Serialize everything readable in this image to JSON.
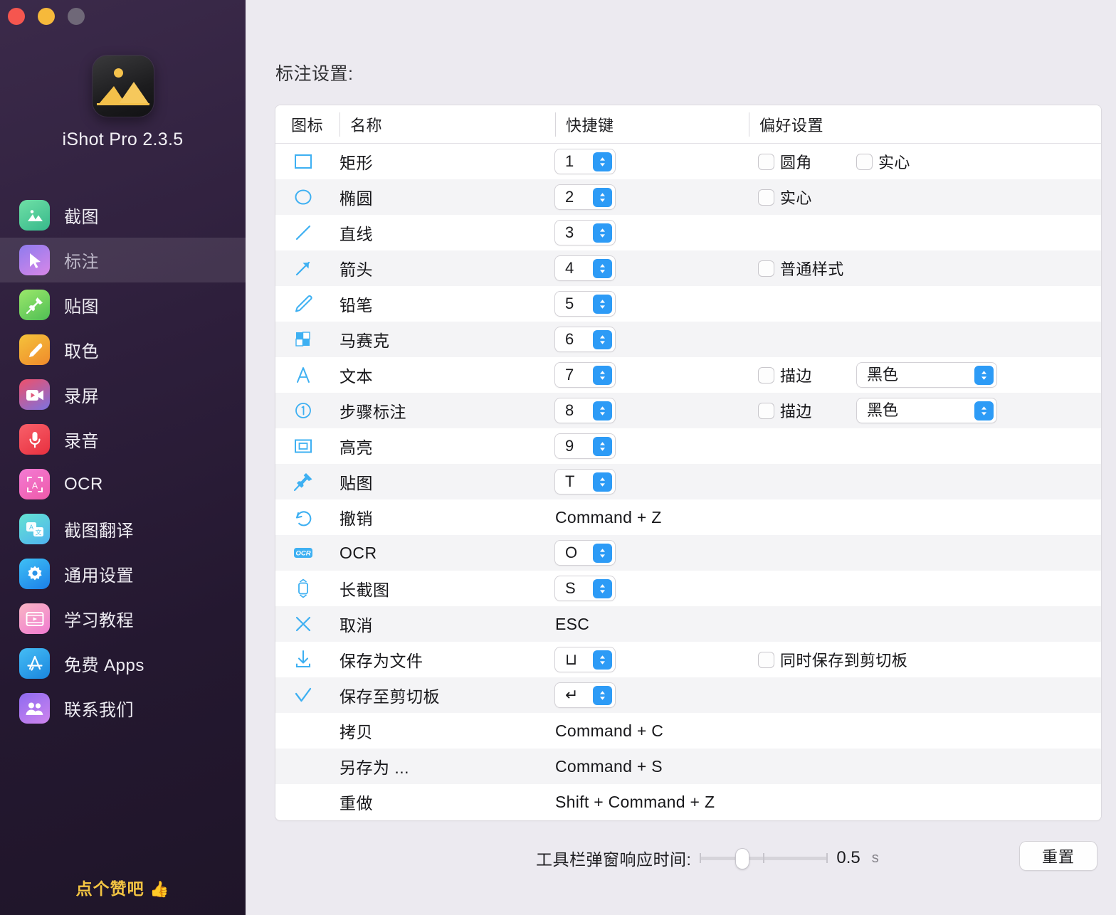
{
  "window": {
    "traffic_lights": [
      "close",
      "minimize",
      "zoom"
    ],
    "app_name": "iShot Pro 2.3.5"
  },
  "sidebar": {
    "items": [
      {
        "label": "截图",
        "icon": "screenshot-icon",
        "active": false
      },
      {
        "label": "标注",
        "icon": "annotate-icon",
        "active": true
      },
      {
        "label": "贴图",
        "icon": "pin-image-icon",
        "active": false
      },
      {
        "label": "取色",
        "icon": "color-picker-icon",
        "active": false
      },
      {
        "label": "录屏",
        "icon": "screen-record-icon",
        "active": false
      },
      {
        "label": "录音",
        "icon": "audio-record-icon",
        "active": false
      },
      {
        "label": "OCR",
        "icon": "ocr-icon",
        "active": false
      },
      {
        "label": "截图翻译",
        "icon": "translate-icon",
        "active": false
      },
      {
        "label": "通用设置",
        "icon": "gear-icon",
        "active": false
      },
      {
        "label": "学习教程",
        "icon": "tutorial-icon",
        "active": false
      },
      {
        "label": "免费 Apps",
        "icon": "app-store-icon",
        "active": false
      },
      {
        "label": "联系我们",
        "icon": "contacts-icon",
        "active": false
      }
    ],
    "praise_text": "点个赞吧",
    "praise_emoji": "👍"
  },
  "main": {
    "section_title": "标注设置:",
    "columns": [
      "图标",
      "名称",
      "快捷键",
      "偏好设置"
    ],
    "rows": [
      {
        "icon": "rectangle-icon",
        "name": "矩形",
        "key": "1",
        "key_type": "stepper",
        "prefs": [
          {
            "type": "checkbox",
            "label": "圆角",
            "checked": false
          },
          {
            "type": "checkbox",
            "label": "实心",
            "checked": false
          }
        ]
      },
      {
        "icon": "ellipse-icon",
        "name": "椭圆",
        "key": "2",
        "key_type": "stepper",
        "prefs": [
          {
            "type": "checkbox",
            "label": "实心",
            "checked": false
          }
        ]
      },
      {
        "icon": "line-icon",
        "name": "直线",
        "key": "3",
        "key_type": "stepper",
        "prefs": []
      },
      {
        "icon": "arrow-icon",
        "name": "箭头",
        "key": "4",
        "key_type": "stepper",
        "prefs": [
          {
            "type": "checkbox",
            "label": "普通样式",
            "checked": false
          }
        ]
      },
      {
        "icon": "pencil-icon",
        "name": "铅笔",
        "key": "5",
        "key_type": "stepper",
        "prefs": []
      },
      {
        "icon": "mosaic-icon",
        "name": "马赛克",
        "key": "6",
        "key_type": "stepper",
        "prefs": []
      },
      {
        "icon": "text-icon",
        "name": "文本",
        "key": "7",
        "key_type": "stepper",
        "prefs": [
          {
            "type": "checkbox",
            "label": "描边",
            "checked": false
          },
          {
            "type": "select",
            "value": "黑色"
          }
        ]
      },
      {
        "icon": "step-number-icon",
        "name": "步骤标注",
        "key": "8",
        "key_type": "stepper",
        "prefs": [
          {
            "type": "checkbox",
            "label": "描边",
            "checked": false
          },
          {
            "type": "select",
            "value": "黑色"
          }
        ]
      },
      {
        "icon": "highlight-icon",
        "name": "高亮",
        "key": "9",
        "key_type": "stepper",
        "prefs": []
      },
      {
        "icon": "sticker-icon",
        "name": "贴图",
        "key": "T",
        "key_type": "stepper",
        "prefs": []
      },
      {
        "icon": "undo-icon",
        "name": "撤销",
        "key": "Command + Z",
        "key_type": "text",
        "prefs": []
      },
      {
        "icon": "ocr-badge-icon",
        "name": "OCR",
        "key": "O",
        "key_type": "stepper",
        "prefs": []
      },
      {
        "icon": "long-screenshot-icon",
        "name": "长截图",
        "key": "S",
        "key_type": "stepper",
        "prefs": []
      },
      {
        "icon": "cancel-icon",
        "name": "取消",
        "key": "ESC",
        "key_type": "text",
        "prefs": []
      },
      {
        "icon": "save-file-icon",
        "name": "保存为文件",
        "key": "⊔",
        "key_type": "stepper",
        "prefs": [
          {
            "type": "checkbox",
            "label": "同时保存到剪切板",
            "checked": false
          }
        ]
      },
      {
        "icon": "save-clipboard-icon",
        "name": "保存至剪切板",
        "key": "↵",
        "key_type": "stepper",
        "prefs": []
      },
      {
        "icon": "none",
        "name": "拷贝",
        "key": "Command + C",
        "key_type": "text",
        "prefs": []
      },
      {
        "icon": "none",
        "name": "另存为 ...",
        "key": "Command + S",
        "key_type": "text",
        "prefs": []
      },
      {
        "icon": "none",
        "name": "重做",
        "key": "Shift + Command + Z",
        "key_type": "text",
        "prefs": []
      }
    ]
  },
  "footer": {
    "slider_label": "工具栏弹窗响应时间:",
    "slider_value": "0.5",
    "slider_unit": "s",
    "slider_percent": 28,
    "reset_label": "重置"
  },
  "colors": {
    "accent_blue": "#2D9BF6",
    "icon_blue": "#3EB0F2",
    "sidebar_bg": "#2E1F3C",
    "main_bg": "#ECEAF0",
    "praise_yellow": "#F4C542"
  }
}
